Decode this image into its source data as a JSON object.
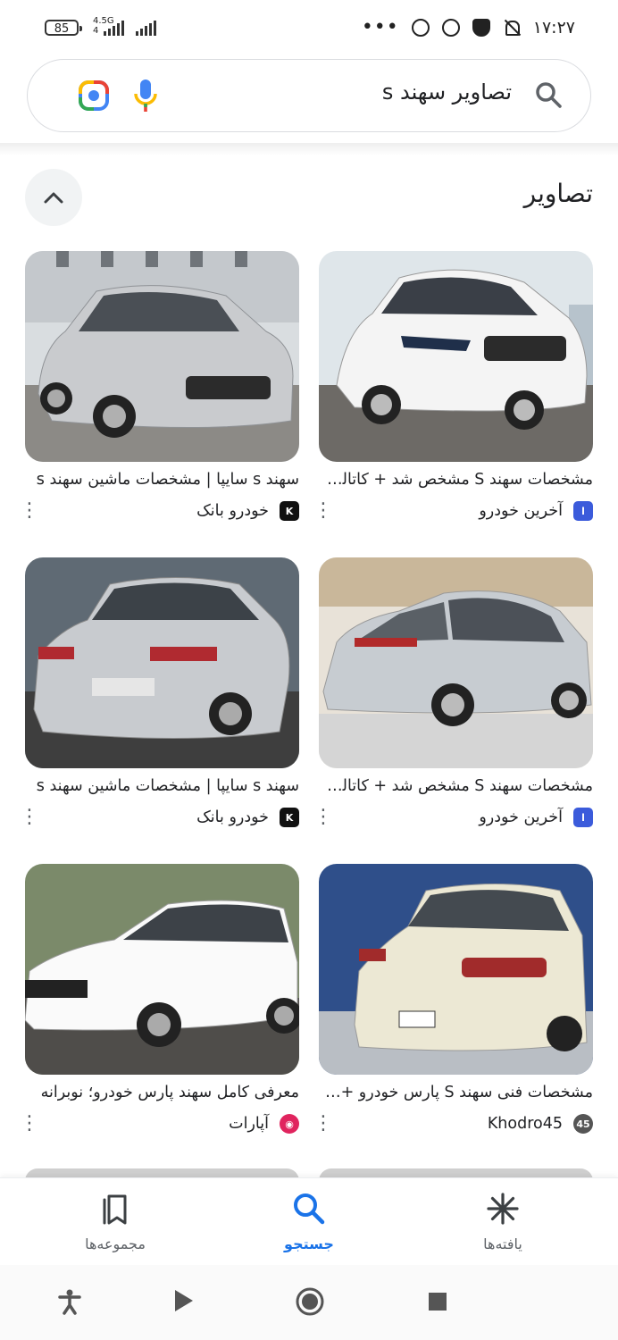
{
  "status_bar": {
    "battery": "85",
    "network_type": "4.5G",
    "network_sub": "4",
    "time": "۱۷:۲۷",
    "overflow": "•••"
  },
  "search": {
    "query": "تصاویر سهند s"
  },
  "section": {
    "title": "تصاویر"
  },
  "results": [
    {
      "caption": "مشخصات سهند S مشخص شد + کاتالوگ",
      "source": "آخرین خودرو",
      "favicon_color": "#3b5bdb"
    },
    {
      "caption": "سهند s سایپا | مشخصات ماشین سهند s",
      "source": "خودرو بانک",
      "favicon_color": "#111111"
    },
    {
      "caption": "مشخصات سهند S مشخص شد + کاتالوگ",
      "source": "آخرین خودرو",
      "favicon_color": "#3b5bdb"
    },
    {
      "caption": "سهند s سایپا | مشخصات ماشین سهند s",
      "source": "خودرو بانک",
      "favicon_color": "#111111"
    },
    {
      "caption": "مشخصات فنی سهند S پارس خودرو + قیمت",
      "source": "Khodro45",
      "favicon_color": "#555555"
    },
    {
      "caption": "معرفی کامل سهند پارس خودرو؛ نوبرانه",
      "source": "آپارات",
      "favicon_color": "#e0245e"
    }
  ],
  "bottom_nav": {
    "items": [
      {
        "label": "یافته‌ها",
        "icon": "asterisk-icon"
      },
      {
        "label": "جستجو",
        "icon": "search-icon"
      },
      {
        "label": "مجموعه‌ها",
        "icon": "collections-icon"
      }
    ]
  },
  "colors": {
    "accent": "#1a73e8",
    "text": "#202124",
    "muted": "#5f6368"
  }
}
